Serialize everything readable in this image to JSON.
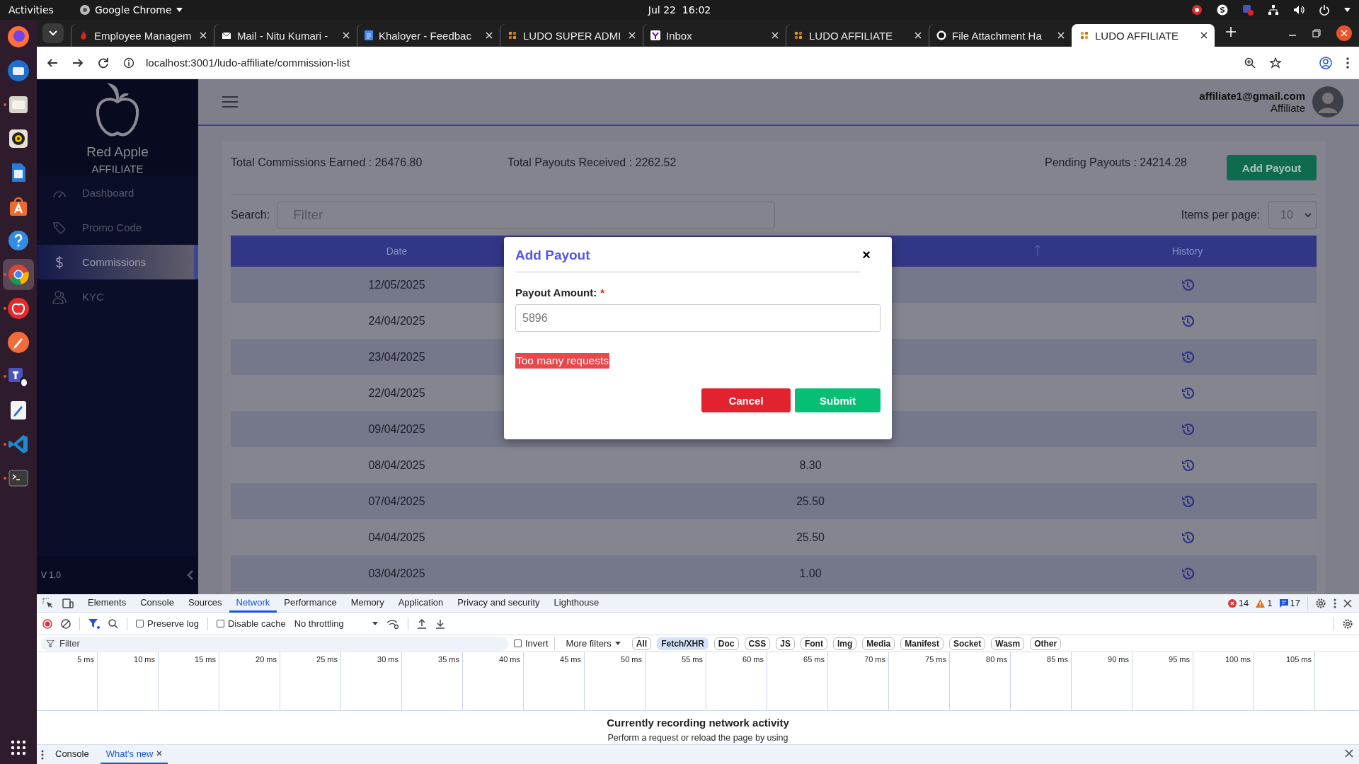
{
  "system_bar": {
    "activities": "Activities",
    "app_menu": "Google Chrome",
    "clock": "Jul 22  16:02"
  },
  "dock": [
    {
      "kind": "firefox",
      "running": false,
      "selected": false
    },
    {
      "kind": "thunderbird",
      "running": false,
      "selected": false
    },
    {
      "kind": "files",
      "running": true,
      "selected": false
    },
    {
      "kind": "rhythmbox",
      "running": false,
      "selected": false
    },
    {
      "kind": "writer",
      "running": false,
      "selected": false
    },
    {
      "kind": "software",
      "running": false,
      "selected": false
    },
    {
      "kind": "help",
      "running": false,
      "selected": false
    },
    {
      "kind": "chrome",
      "running": true,
      "selected": true
    },
    {
      "kind": "apple",
      "running": true,
      "selected": false
    },
    {
      "kind": "postman",
      "running": false,
      "selected": false
    },
    {
      "kind": "teams",
      "running": true,
      "selected": false
    },
    {
      "kind": "editor",
      "running": false,
      "selected": false
    },
    {
      "kind": "vscode",
      "running": true,
      "selected": false
    },
    {
      "kind": "terminal",
      "running": true,
      "selected": false
    }
  ],
  "browser": {
    "tabs": [
      {
        "title": "Employee Managem",
        "kind": "red",
        "selected": false
      },
      {
        "title": "Mail - Nitu Kumari -",
        "kind": "mail",
        "selected": false
      },
      {
        "title": "Khaloyer - Feedbac",
        "kind": "docs",
        "selected": false
      },
      {
        "title": "LUDO SUPER ADMI",
        "kind": "ludo",
        "selected": false
      },
      {
        "title": "Inbox",
        "kind": "yahoo",
        "selected": false
      },
      {
        "title": "LUDO AFFILIATE",
        "kind": "ludo",
        "selected": false
      },
      {
        "title": "File Attachment Ha",
        "kind": "github",
        "selected": false
      },
      {
        "title": "LUDO AFFILIATE",
        "kind": "ludo",
        "selected": true
      }
    ],
    "url": "localhost:3001/ludo-affiliate/commission-list"
  },
  "sidebar": {
    "brand": "Red Apple",
    "subtitle": "AFFILIATE",
    "items": [
      {
        "label": "Dashboard",
        "kind": "gauge",
        "selected": false
      },
      {
        "label": "Promo Code",
        "kind": "tag",
        "selected": false
      },
      {
        "label": "Commissions",
        "kind": "dollar",
        "selected": true
      },
      {
        "label": "KYC",
        "kind": "users",
        "selected": false
      }
    ],
    "version": "V 1.0"
  },
  "header": {
    "email": "affiliate1@gmail.com",
    "role": "Affiliate"
  },
  "summary": {
    "earned": "Total Commissions Earned : 26476.80",
    "received": "Total Payouts Received : 2262.52",
    "pending": "Pending Payouts : 24214.28",
    "button": "Add Payout"
  },
  "search": {
    "label": "Search:",
    "placeholder": "Filter"
  },
  "pagination": {
    "label": "Items per page:",
    "value": "10"
  },
  "table": {
    "columns": [
      {
        "label": "Date"
      },
      {
        "sort_arrow": true
      },
      {
        "label": "History"
      }
    ],
    "rows": [
      {
        "date": "12/05/2025"
      },
      {
        "date": "24/04/2025"
      },
      {
        "date": "23/04/2025"
      },
      {
        "date": "22/04/2025"
      },
      {
        "date": "09/04/2025"
      },
      {
        "date": "08/04/2025",
        "amount": "8.30"
      },
      {
        "date": "07/04/2025",
        "amount": "25.50"
      },
      {
        "date": "04/04/2025",
        "amount": "25.50"
      },
      {
        "date": "03/04/2025",
        "amount": "1.00"
      }
    ]
  },
  "modal": {
    "title": "Add Payout",
    "close": "×",
    "field_label": "Payout Amount:",
    "required_mark": "*",
    "value": "5896",
    "error": "Too many requests",
    "buttons": [
      {
        "label": "Cancel",
        "kind": "cancel"
      },
      {
        "label": "Submit",
        "kind": "submit"
      }
    ]
  },
  "devtools": {
    "tabs": [
      {
        "label": "Elements",
        "selected": false
      },
      {
        "label": "Console",
        "selected": false
      },
      {
        "label": "Sources",
        "selected": false
      },
      {
        "label": "Network",
        "selected": true
      },
      {
        "label": "Performance",
        "selected": false
      },
      {
        "label": "Memory",
        "selected": false
      },
      {
        "label": "Application",
        "selected": false
      },
      {
        "label": "Privacy and security",
        "selected": false
      },
      {
        "label": "Lighthouse",
        "selected": false
      }
    ],
    "counts": {
      "errors": "14",
      "warnings": "1",
      "messages": "17"
    },
    "preserve_log": {
      "label": "Preserve log",
      "checked": false
    },
    "disable_cache": {
      "label": "Disable cache",
      "checked": false
    },
    "throttling": "No throttling",
    "filter": {
      "placeholder": "Filter",
      "invert": {
        "label": "Invert",
        "checked": false
      },
      "more_filters": "More filters",
      "types": [
        {
          "label": "All",
          "selected": false
        },
        {
          "label": "Fetch/XHR",
          "selected": true
        },
        {
          "label": "Doc",
          "selected": false
        },
        {
          "label": "CSS",
          "selected": false
        },
        {
          "label": "JS",
          "selected": false
        },
        {
          "label": "Font",
          "selected": false
        },
        {
          "label": "Img",
          "selected": false
        },
        {
          "label": "Media",
          "selected": false
        },
        {
          "label": "Manifest",
          "selected": false
        },
        {
          "label": "Socket",
          "selected": false
        },
        {
          "label": "Wasm",
          "selected": false
        },
        {
          "label": "Other",
          "selected": false
        }
      ]
    },
    "ticks": [
      "5 ms",
      "10 ms",
      "15 ms",
      "20 ms",
      "25 ms",
      "30 ms",
      "35 ms",
      "40 ms",
      "45 ms",
      "50 ms",
      "55 ms",
      "60 ms",
      "65 ms",
      "70 ms",
      "75 ms",
      "80 ms",
      "85 ms",
      "90 ms",
      "95 ms",
      "100 ms",
      "105 ms"
    ],
    "message": {
      "title": "Currently recording network activity",
      "hint": "Perform a request or reload the page by using"
    },
    "drawer": [
      {
        "label": "Console",
        "selected": false,
        "closable": false
      },
      {
        "label": "What's new",
        "selected": true,
        "closable": true
      }
    ]
  }
}
